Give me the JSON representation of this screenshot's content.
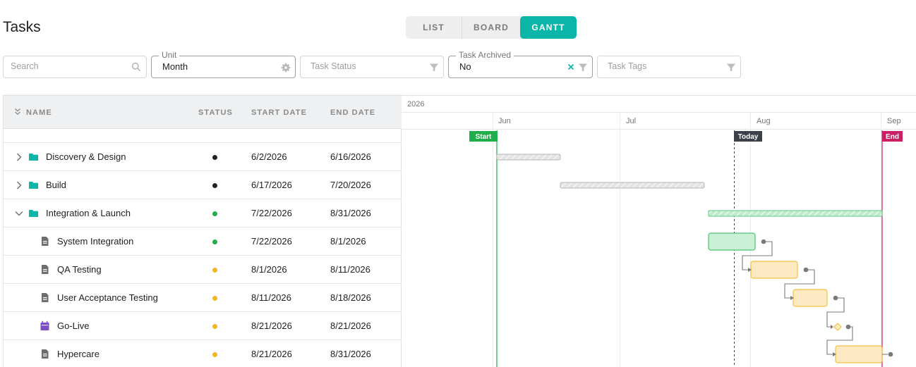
{
  "page": {
    "title": "Tasks"
  },
  "view_switch": {
    "items": [
      "LIST",
      "BOARD",
      "GANTT"
    ],
    "active": "GANTT"
  },
  "filters": {
    "search": {
      "placeholder": "Search",
      "icon": "search-icon"
    },
    "unit": {
      "label": "Unit",
      "value": "Month",
      "icon": "gear-icon"
    },
    "task_status": {
      "placeholder": "Task Status",
      "icon": "filter-icon"
    },
    "task_archived": {
      "label": "Task Archived",
      "value": "No",
      "icons": [
        "clear-icon",
        "filter-icon"
      ]
    },
    "task_tags": {
      "placeholder": "Task Tags",
      "icon": "filter-icon"
    }
  },
  "grid": {
    "columns": {
      "name": "NAME",
      "status": "STATUS",
      "start": "START DATE",
      "end": "END DATE"
    },
    "rows": [
      {
        "name": "Discovery & Design",
        "type": "folder",
        "expanded": false,
        "status_color": "#212121",
        "start": "6/2/2026",
        "end": "6/16/2026"
      },
      {
        "name": "Build",
        "type": "folder",
        "expanded": false,
        "status_color": "#212121",
        "start": "6/17/2026",
        "end": "7/20/2026"
      },
      {
        "name": "Integration & Launch",
        "type": "folder",
        "expanded": true,
        "status_color": "#1fae4a",
        "start": "7/22/2026",
        "end": "8/31/2026"
      },
      {
        "name": "System Integration",
        "type": "task",
        "status_color": "#1fae4a",
        "start": "7/22/2026",
        "end": "8/1/2026"
      },
      {
        "name": "QA Testing",
        "type": "task",
        "status_color": "#f5b51c",
        "start": "8/1/2026",
        "end": "8/11/2026"
      },
      {
        "name": "User Acceptance Testing",
        "type": "task",
        "status_color": "#f5b51c",
        "start": "8/11/2026",
        "end": "8/18/2026"
      },
      {
        "name": "Go-Live",
        "type": "milestone",
        "status_color": "#f5b51c",
        "start": "8/21/2026",
        "end": "8/21/2026"
      },
      {
        "name": "Hypercare",
        "type": "task",
        "status_color": "#f5b51c",
        "start": "8/21/2026",
        "end": "8/31/2026"
      }
    ]
  },
  "gantt": {
    "year": "2026",
    "months": [
      "Jun",
      "Jul",
      "Aug",
      "Sep"
    ],
    "markers": {
      "start": "Start",
      "today": "Today",
      "end": "End"
    },
    "colors": {
      "teal": "#0bb5a8",
      "start": "#1fae4a",
      "end": "#cc1f66",
      "today": "#3c4048",
      "green_bar": "#c9efd6",
      "yellow_bar": "#fde9c2",
      "summary_grey": "#d9d9d9"
    }
  }
}
